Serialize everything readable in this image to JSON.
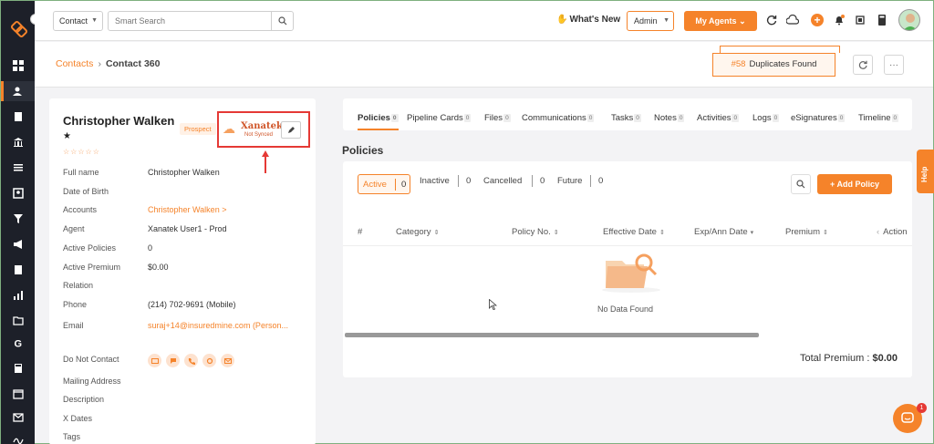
{
  "colors": {
    "accent": "#f5832a",
    "sidebar": "#1d2029",
    "highlight": "#e53935"
  },
  "topbar": {
    "contact_select": "Contact",
    "search_placeholder": "Smart Search",
    "whats_new": "What's New",
    "admin_select": "Admin",
    "my_agents": "My Agents"
  },
  "breadcrumb": {
    "contacts": "Contacts",
    "current": "Contact 360"
  },
  "duplicates": {
    "number": "#58",
    "label": "Duplicates Found"
  },
  "contact": {
    "name": "Christopher Walken",
    "prospect_badge": "Prospect",
    "stars": "☆☆☆☆☆",
    "xanatek_name": "Xanatek",
    "xanatek_status": "Not Synced",
    "fields": [
      {
        "label": "Full name",
        "value": "Christopher Walken",
        "style": ""
      },
      {
        "label": "Date of Birth",
        "value": "",
        "style": ""
      },
      {
        "label": "Accounts",
        "value": "Christopher Walken >",
        "style": "orange"
      },
      {
        "label": "Agent",
        "value": "Xanatek User1 - Prod",
        "style": ""
      },
      {
        "label": "Active Policies",
        "value": "0",
        "style": ""
      },
      {
        "label": "Active Premium",
        "value": "$0.00",
        "style": ""
      },
      {
        "label": "Relation",
        "value": "",
        "style": ""
      },
      {
        "label": "Phone",
        "value": "(214) 702-9691 (Mobile)",
        "style": ""
      },
      {
        "label": "Email",
        "value": "suraj+14@insuredmine.com  (Person...",
        "style": "orange"
      },
      {
        "label": "Do Not Contact",
        "value": "",
        "style": ""
      },
      {
        "label": "Mailing Address",
        "value": "",
        "style": ""
      },
      {
        "label": "Description",
        "value": "",
        "style": ""
      },
      {
        "label": "X Dates",
        "value": "",
        "style": ""
      },
      {
        "label": "Tags",
        "value": "",
        "style": ""
      }
    ]
  },
  "tabs": [
    {
      "label": "Policies",
      "count": "0"
    },
    {
      "label": "Pipeline Cards",
      "count": "0"
    },
    {
      "label": "Files",
      "count": "0"
    },
    {
      "label": "Communications",
      "count": "0"
    },
    {
      "label": "Tasks",
      "count": "0"
    },
    {
      "label": "Notes",
      "count": "0"
    },
    {
      "label": "Activities",
      "count": "0"
    },
    {
      "label": "Logs",
      "count": "0"
    },
    {
      "label": "eSignatures",
      "count": "0"
    },
    {
      "label": "Timeline",
      "count": "0"
    }
  ],
  "policies": {
    "title": "Policies",
    "filters": [
      {
        "label": "Active",
        "count": "0"
      },
      {
        "label": "Inactive",
        "count": "0"
      },
      {
        "label": "Cancelled",
        "count": "0"
      },
      {
        "label": "Future",
        "count": "0"
      }
    ],
    "add_button": "+  Add Policy",
    "columns": [
      "#",
      "Category",
      "Policy No.",
      "Effective Date",
      "Exp/Ann Date",
      "Premium",
      "Action"
    ],
    "empty_text": "No Data Found",
    "total_label": "Total Premium : ",
    "total_value": "$0.00"
  },
  "help_label": "Help",
  "chat_badge": "1"
}
